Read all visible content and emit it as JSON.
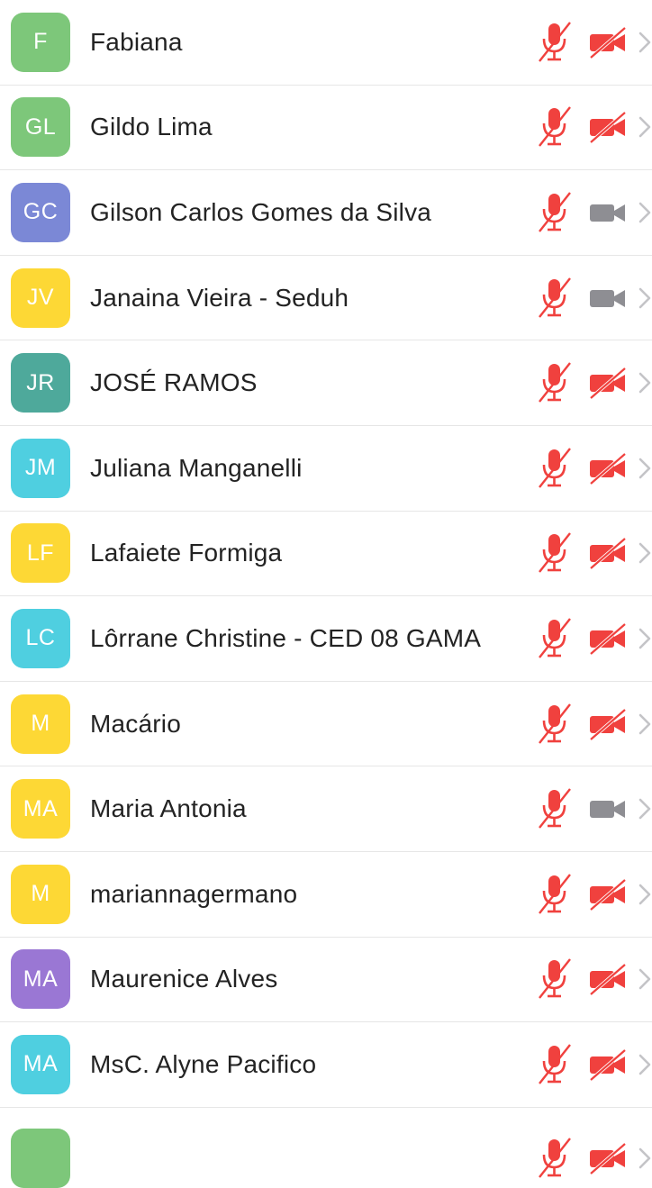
{
  "colors": {
    "muted_red": "#f0413e",
    "video_on_grey": "#8e8e93",
    "chevron_grey": "#c4c4c7",
    "green": "#7dc77a",
    "indigo": "#7b88d6",
    "yellow": "#fdd835",
    "teal": "#4ea99b",
    "cyan": "#4fcfe0",
    "purple": "#9a77d4"
  },
  "participants": [
    {
      "initials": "F",
      "name": "Fabiana",
      "color": "#7dc77a",
      "mic": "muted",
      "video": "off"
    },
    {
      "initials": "GL",
      "name": "Gildo Lima",
      "color": "#7dc77a",
      "mic": "muted",
      "video": "off"
    },
    {
      "initials": "GC",
      "name": "Gilson Carlos Gomes da Silva",
      "color": "#7b88d6",
      "mic": "muted",
      "video": "on"
    },
    {
      "initials": "JV",
      "name": "Janaina Vieira - Seduh",
      "color": "#fdd835",
      "mic": "muted",
      "video": "on"
    },
    {
      "initials": "JR",
      "name": "JOSÉ RAMOS",
      "color": "#4ea99b",
      "mic": "muted",
      "video": "off"
    },
    {
      "initials": "JM",
      "name": "Juliana Manganelli",
      "color": "#4fcfe0",
      "mic": "muted",
      "video": "off"
    },
    {
      "initials": "LF",
      "name": "Lafaiete Formiga",
      "color": "#fdd835",
      "mic": "muted",
      "video": "off"
    },
    {
      "initials": "LC",
      "name": "Lôrrane Christine - CED 08 GAMA",
      "color": "#4fcfe0",
      "mic": "muted",
      "video": "off"
    },
    {
      "initials": "M",
      "name": "Macário",
      "color": "#fdd835",
      "mic": "muted",
      "video": "off"
    },
    {
      "initials": "MA",
      "name": "Maria Antonia",
      "color": "#fdd835",
      "mic": "muted",
      "video": "on"
    },
    {
      "initials": "M",
      "name": "mariannagermano",
      "color": "#fdd835",
      "mic": "muted",
      "video": "off"
    },
    {
      "initials": "MA",
      "name": "Maurenice Alves",
      "color": "#9a77d4",
      "mic": "muted",
      "video": "off"
    },
    {
      "initials": "MA",
      "name": "MsC. Alyne Pacifico",
      "color": "#4fcfe0",
      "mic": "muted",
      "video": "off"
    }
  ],
  "partial_row": {
    "color": "#7dc77a",
    "mic": "muted",
    "video": "off"
  }
}
